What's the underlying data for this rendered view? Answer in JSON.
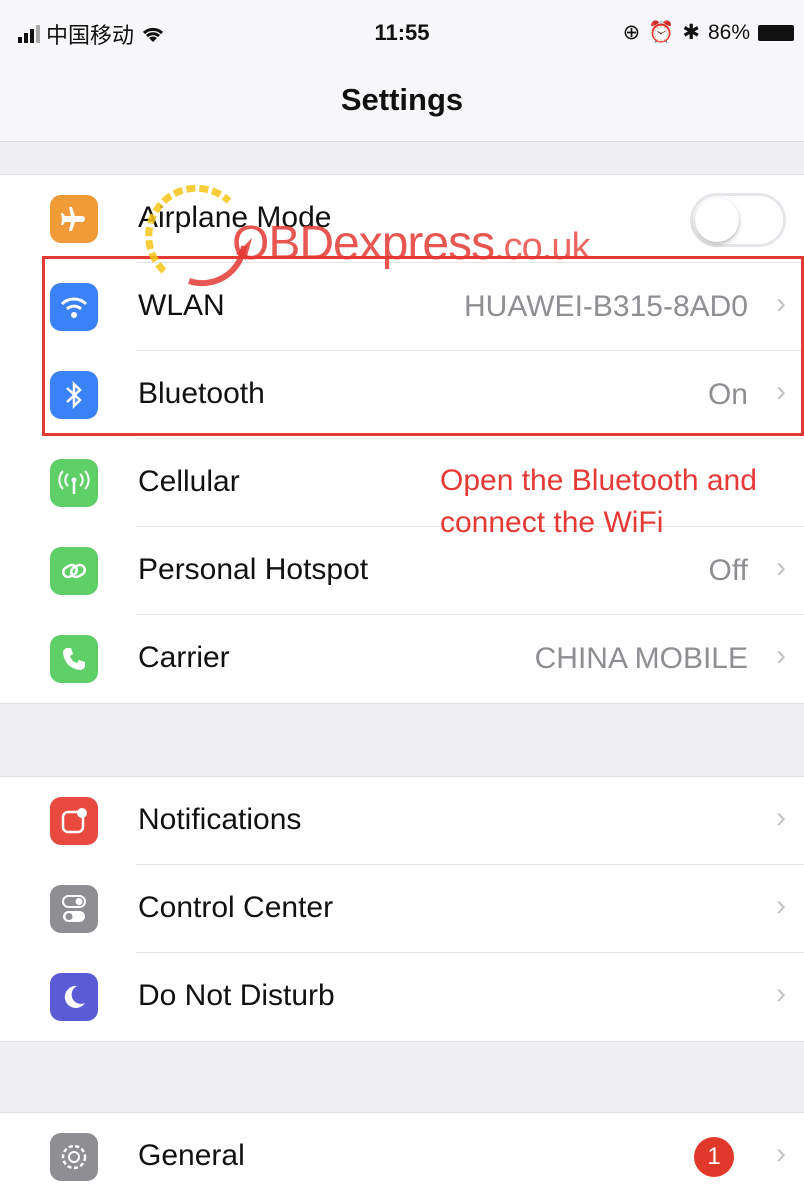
{
  "status": {
    "carrier": "中国移动",
    "time": "11:55",
    "battery": "86%",
    "icons": [
      "signal-bars",
      "wifi-icon",
      "lock-rotation-icon",
      "alarm-icon",
      "bluetooth-icon",
      "battery-icon"
    ]
  },
  "nav": {
    "title": "Settings"
  },
  "group1": [
    {
      "key": "airplane",
      "label": "Airplane Mode",
      "toggle": false,
      "color": "#f19a38",
      "icon": "airplane-icon"
    },
    {
      "key": "wlan",
      "label": "WLAN",
      "value": "HUAWEI-B315-8AD0",
      "color": "#3b82f6",
      "icon": "wifi-icon"
    },
    {
      "key": "bluetooth",
      "label": "Bluetooth",
      "value": "On",
      "color": "#3b82f6",
      "icon": "bluetooth-icon"
    },
    {
      "key": "cellular",
      "label": "Cellular",
      "color": "#5fd068",
      "icon": "antenna-icon"
    },
    {
      "key": "hotspot",
      "label": "Personal Hotspot",
      "value": "Off",
      "color": "#5fd068",
      "icon": "chain-link-icon"
    },
    {
      "key": "carrier",
      "label": "Carrier",
      "value": "CHINA MOBILE",
      "color": "#5fd068",
      "icon": "phone-icon"
    }
  ],
  "group2": [
    {
      "key": "notifications",
      "label": "Notifications",
      "color": "#e84a3f",
      "icon": "notification-icon"
    },
    {
      "key": "control-center",
      "label": "Control Center",
      "color": "#8e8e93",
      "icon": "switches-icon"
    },
    {
      "key": "dnd",
      "label": "Do Not Disturb",
      "color": "#5b5bd6",
      "icon": "moon-icon"
    }
  ],
  "group3": [
    {
      "key": "general",
      "label": "General",
      "badge": "1",
      "color": "#8e8e93",
      "icon": "gear-icon"
    }
  ],
  "annotation": [
    "Open the Bluetooth and",
    "connect the WiFi"
  ],
  "watermark": {
    "main": "OBDexpress",
    "suffix": ".co.uk"
  },
  "chevron": "›"
}
